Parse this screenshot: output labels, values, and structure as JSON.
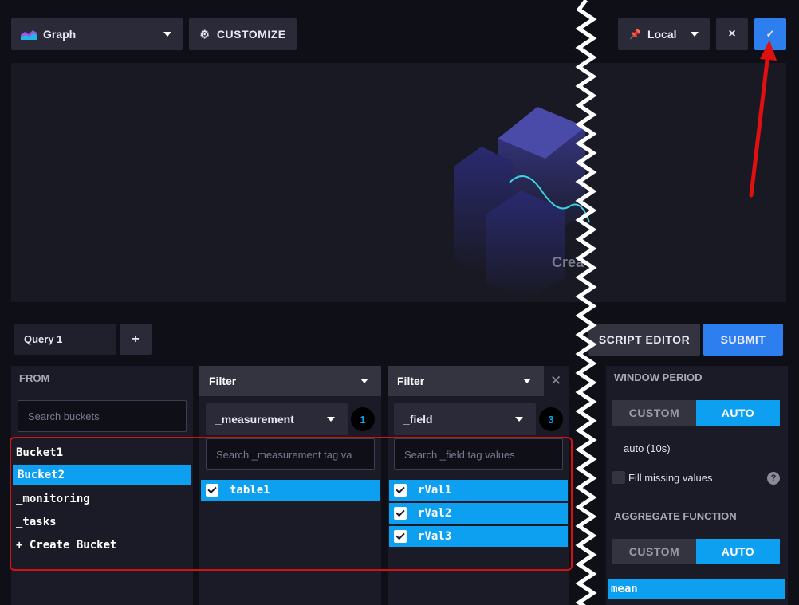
{
  "toolbar": {
    "graph_label": "Graph",
    "customize_label": "CUSTOMIZE",
    "timezone_label": "Local",
    "close_symbol": "×",
    "confirm_symbol": "✓"
  },
  "preview": {
    "partial_text": "Crea"
  },
  "query_tabs": {
    "tab1_label": "Query 1",
    "add_symbol": "+"
  },
  "actions": {
    "script_editor_label": "SCRIPT EDITOR",
    "submit_label": "SUBMIT"
  },
  "from": {
    "header": "FROM",
    "search_placeholder": "Search buckets",
    "items": [
      "Bucket1",
      "Bucket2",
      "_monitoring",
      "_tasks",
      "+ Create Bucket"
    ],
    "selected": "Bucket2"
  },
  "filter1": {
    "header": "Filter",
    "key": "_measurement",
    "count": "1",
    "search_placeholder": "Search _measurement tag va",
    "items": [
      "table1"
    ]
  },
  "filter2": {
    "header": "Filter",
    "key": "_field",
    "count": "3",
    "search_placeholder": "Search _field tag values",
    "items": [
      "rVal1",
      "rVal2",
      "rVal3"
    ],
    "remove_symbol": "✕"
  },
  "window": {
    "header": "WINDOW PERIOD",
    "custom_label": "CUSTOM",
    "auto_label": "AUTO",
    "value": "auto (10s)",
    "fill_missing_label": "Fill missing values",
    "help_symbol": "?"
  },
  "aggregate": {
    "header": "AGGREGATE FUNCTION",
    "custom_label": "CUSTOM",
    "auto_label": "AUTO",
    "selected_fn": "mean"
  },
  "colors": {
    "accent": "#0ea0f0",
    "submit": "#2d7ff0",
    "annotation": "#e01010"
  }
}
